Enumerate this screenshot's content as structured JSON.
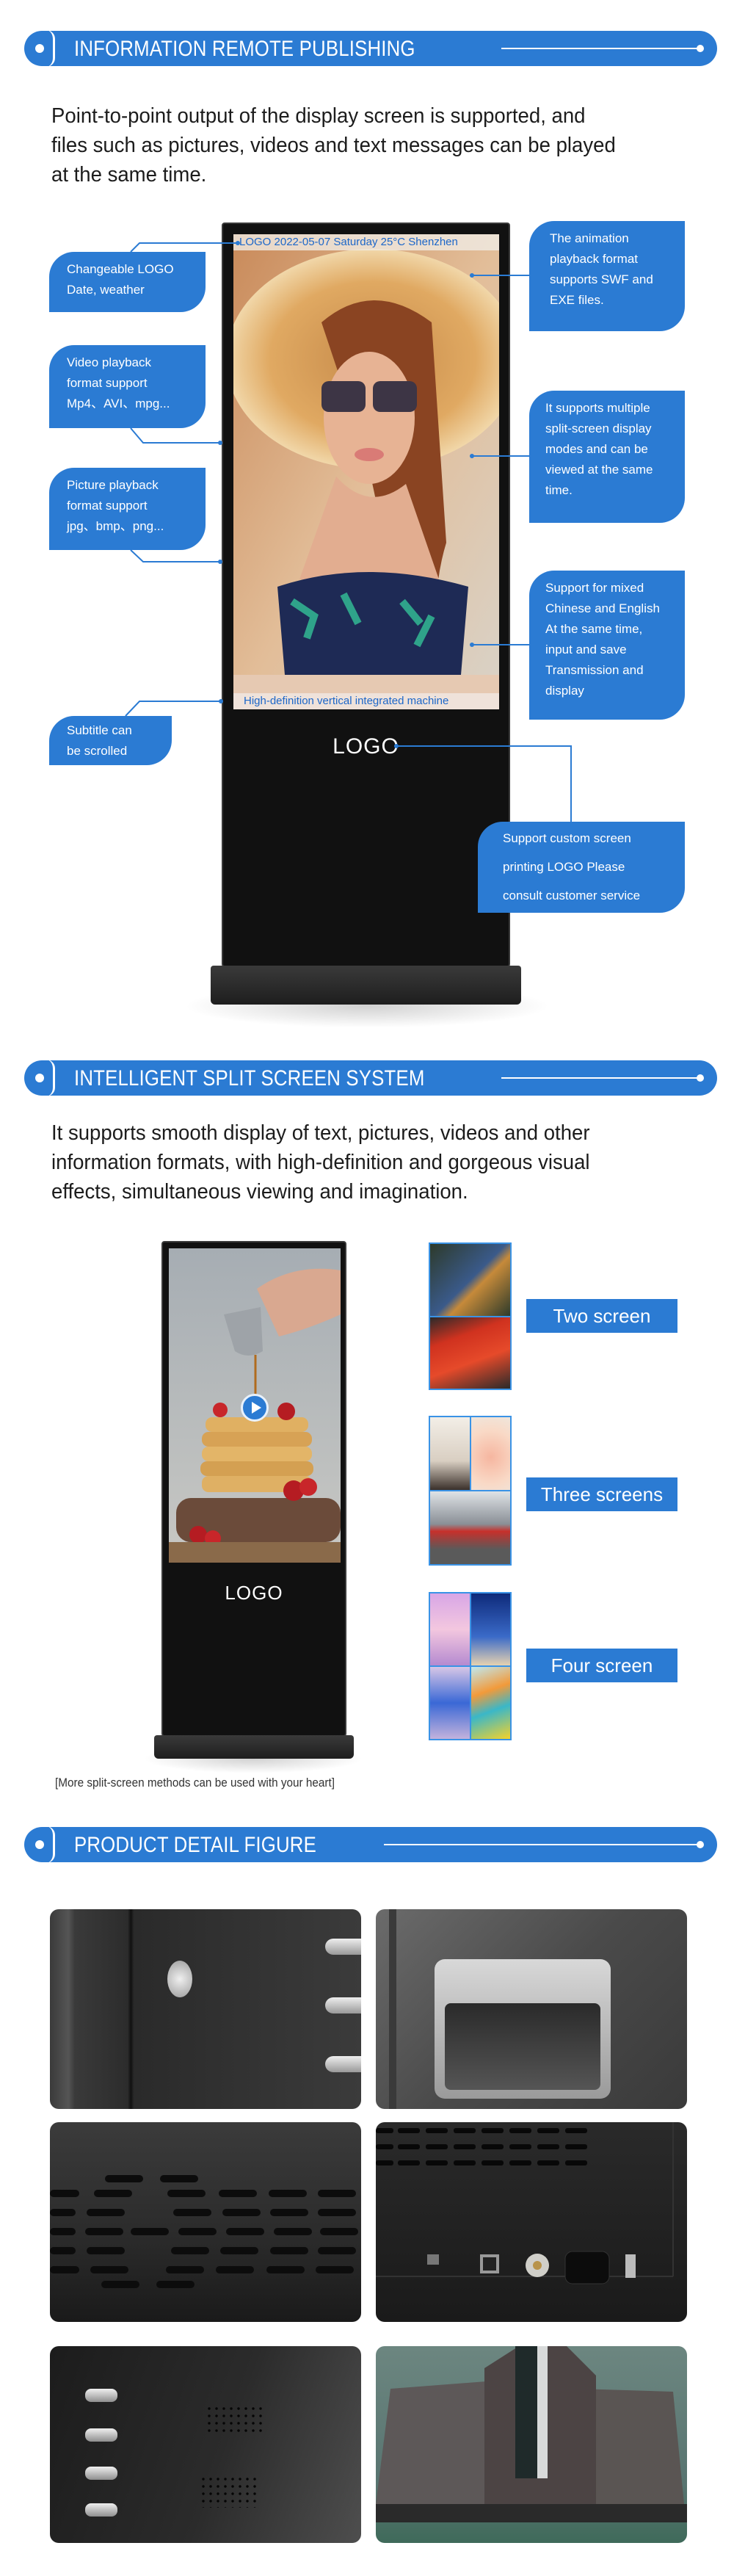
{
  "colors": {
    "accent": "#2b7bd3",
    "thumb_border": "#3a93e6",
    "kiosk_body": "#111111"
  },
  "sections": {
    "remote_publishing": {
      "title": "INFORMATION REMOTE PUBLISHING",
      "intro_lines": [
        "Point-to-point output of the display screen is supported, and",
        "files such as pictures, videos and text messages can be played",
        "at the same time."
      ],
      "kiosk": {
        "ticker_top": "LOGO 2022-05-07  Saturday  25°C  Shenzhen",
        "ticker_bottom": "High-definition vertical integrated machine",
        "logo": "LOGO"
      },
      "callouts_left": [
        {
          "lines": [
            "Changeable LOGO",
            "Date, weather"
          ]
        },
        {
          "lines": [
            "Video playback",
            "format support",
            "Mp4、AVI、mpg..."
          ]
        },
        {
          "lines": [
            "Picture playback",
            "format support",
            "jpg、bmp、png..."
          ]
        },
        {
          "lines": [
            "Subtitle can",
            "be scrolled"
          ]
        }
      ],
      "callouts_right": [
        {
          "lines": [
            "The animation",
            "playback format",
            "supports SWF and",
            "EXE files."
          ]
        },
        {
          "lines": [
            "It supports multiple",
            "split-screen display",
            "modes and can be",
            "viewed at the same",
            "time."
          ]
        },
        {
          "lines": [
            "Support for mixed",
            "Chinese and English",
            "At the same time,",
            "input and save",
            "Transmission and",
            "display"
          ]
        },
        {
          "lines": [
            "Support custom screen",
            "printing LOGO Please",
            "consult customer service"
          ]
        }
      ]
    },
    "split_screen": {
      "title": "INTELLIGENT SPLIT SCREEN SYSTEM",
      "intro_lines": [
        "It supports smooth display of text, pictures, videos and other",
        "information formats, with high-definition and gorgeous visual",
        "effects, simultaneous viewing and imagination."
      ],
      "kiosk": {
        "logo": "LOGO",
        "play_icon": "play-icon"
      },
      "modes": [
        {
          "label": "Two screen",
          "panes": 2
        },
        {
          "label": "Three screens",
          "panes": 3
        },
        {
          "label": "Four screen",
          "panes": 4
        }
      ],
      "caption": "[More split-screen methods can be used with your heart]"
    },
    "detail": {
      "title": "PRODUCT DETAIL FIGURE",
      "images": [
        {
          "name": "lock-and-vents"
        },
        {
          "name": "recessed-handle"
        },
        {
          "name": "speaker-grille"
        },
        {
          "name": "io-ports-panel"
        },
        {
          "name": "side-vents-speaker"
        },
        {
          "name": "base-stand"
        }
      ]
    }
  }
}
